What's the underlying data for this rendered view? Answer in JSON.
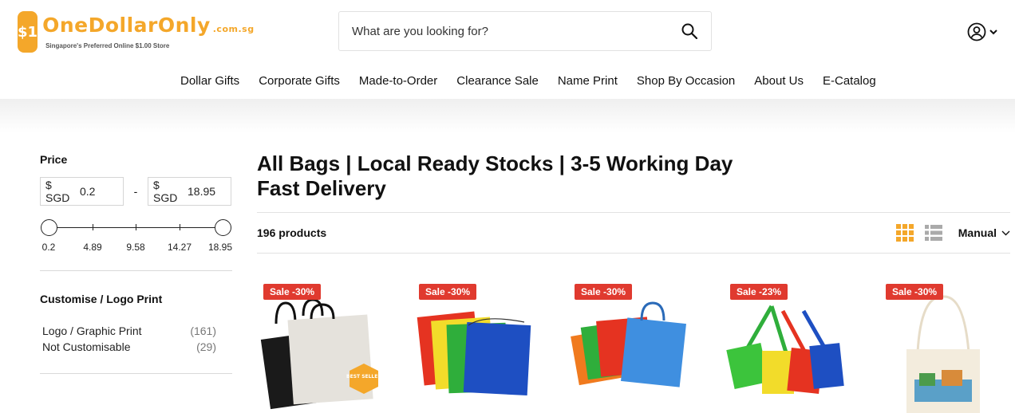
{
  "header": {
    "logo_badge": "$1",
    "logo_name": "OneDollarOnly",
    "logo_domain": ".com.sg",
    "logo_tagline": "Singapore's Preferred Online $1.00 Store",
    "search_placeholder": "What are you looking for?"
  },
  "nav": [
    "Dollar Gifts",
    "Corporate Gifts",
    "Made-to-Order",
    "Clearance Sale",
    "Name Print",
    "Shop By Occasion",
    "About Us",
    "E-Catalog"
  ],
  "filters": {
    "price_title": "Price",
    "currency": "$ SGD",
    "min": "0.2",
    "max": "18.95",
    "dash": "-",
    "slider_labels": [
      "0.2",
      "4.89",
      "9.58",
      "14.27",
      "18.95"
    ],
    "custom_title": "Customise / Logo Print",
    "options": [
      {
        "label": "Logo / Graphic Print",
        "count": "(161)"
      },
      {
        "label": "Not Customisable",
        "count": "(29)"
      }
    ]
  },
  "main": {
    "title": "All Bags | Local Ready Stocks | 3-5 Working Day Fast Delivery",
    "product_count": "196 products",
    "sort": "Manual"
  },
  "products": [
    {
      "badge": "Sale -30%",
      "name": "tote-bag-black-white",
      "best_seller": "BEST SELLER"
    },
    {
      "badge": "Sale -30%",
      "name": "drawstring-bags"
    },
    {
      "badge": "Sale -30%",
      "name": "non-woven-bags"
    },
    {
      "badge": "Sale -23%",
      "name": "lanyard-pouches"
    },
    {
      "badge": "Sale -30%",
      "name": "canvas-tote-print"
    }
  ],
  "colors": {
    "brand": "#f4a72a",
    "sale": "#e03a2f"
  }
}
